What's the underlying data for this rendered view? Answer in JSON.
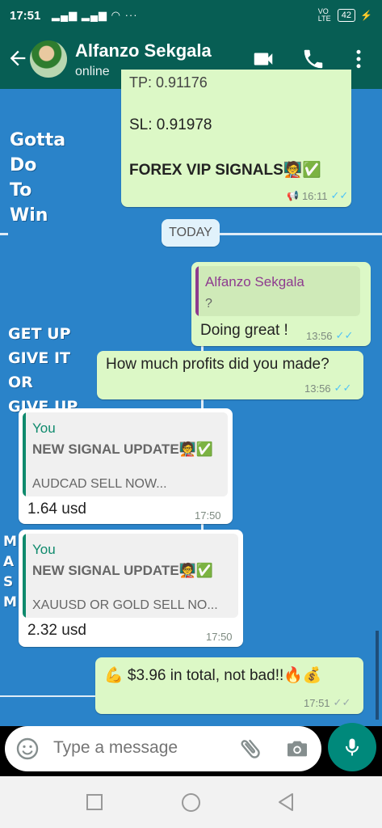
{
  "status_bar": {
    "time": "17:51",
    "battery": "42",
    "network": "VO LTE"
  },
  "header": {
    "contact_name": "Alfanzo Sekgala",
    "contact_status": "online"
  },
  "wallpaper": {
    "text1": [
      "Gotta",
      "Do",
      "To",
      "Win"
    ],
    "text2": [
      "GET UP",
      "GIVE IT",
      "OR",
      "GIVE UP"
    ],
    "text3": [
      "M",
      "A",
      "S",
      "M"
    ]
  },
  "messages": {
    "m1": {
      "partial_line": "TP: 0.91176",
      "sl": "SL: 0.91978",
      "signals": "FOREX VIP SIGNALS🧑‍🏫✅",
      "time": "16:11"
    },
    "today": "TODAY",
    "m2": {
      "quote_author": "Alfanzo Sekgala",
      "quote_text": "?",
      "text": "Doing great !",
      "time": "13:56"
    },
    "m3": {
      "text": "How much profits did you made?",
      "time": "13:56"
    },
    "m4": {
      "quote_author": "You",
      "quote_title": "NEW SIGNAL UPDATE🧑‍🏫✅",
      "quote_text": "AUDCAD SELL NOW...",
      "text": "1.64 usd",
      "time": "17:50"
    },
    "m5": {
      "quote_author": "You",
      "quote_title": "NEW SIGNAL UPDATE🧑‍🏫✅",
      "quote_text": "XAUUSD OR GOLD SELL NO...",
      "text": "2.32 usd",
      "time": "17:50"
    },
    "m6": {
      "text": "💪 $3.96 in total, not bad!!🔥💰",
      "time": "17:51"
    }
  },
  "input": {
    "placeholder": "Type a message"
  },
  "colors": {
    "header": "#075e54",
    "out_bubble": "#dcf8c6",
    "in_bubble": "#ffffff",
    "accent": "#00897b",
    "tick_read": "#4fc3f7"
  }
}
